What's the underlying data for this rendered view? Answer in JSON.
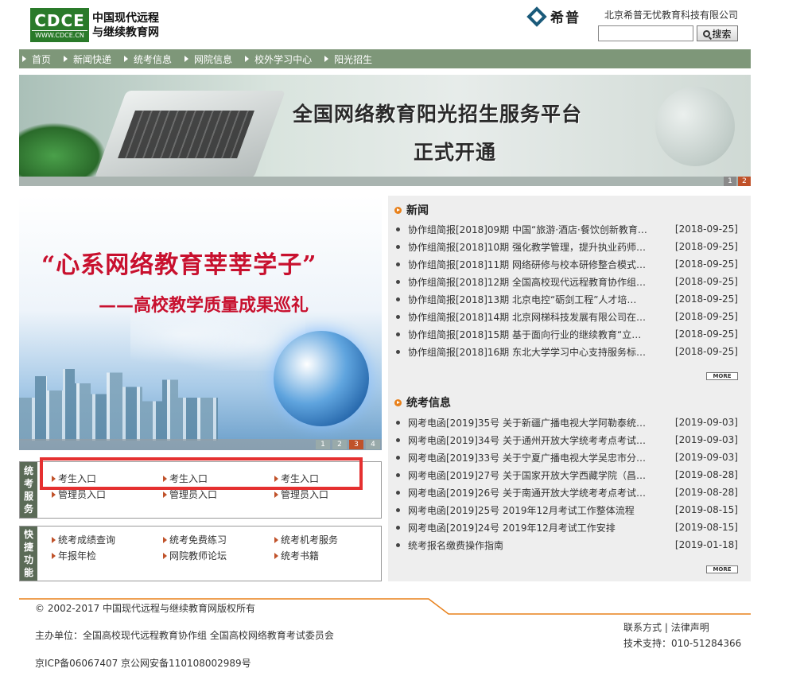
{
  "header": {
    "logo_mark": "CDCE",
    "logo_url": "WWW.CDCE.CN",
    "logo_line1": "中国现代远程",
    "logo_line2": "与继续教育网",
    "partner_name": "希普",
    "company": "北京希普无忧教育科技有限公司",
    "search_placeholder": "",
    "search_button": "搜索"
  },
  "nav": [
    "首页",
    "新闻快递",
    "统考信息",
    "网院信息",
    "校外学习中心",
    "阳光招生"
  ],
  "banner": {
    "title": "全国网络教育阳光招生服务平台",
    "subtitle": "正式开通",
    "pages": [
      "1",
      "2"
    ]
  },
  "slide": {
    "title": "“心系网络教育莘莘学子”",
    "subtitle": "——高校教学质量成果巡礼",
    "pages": [
      "1",
      "2",
      "3",
      "4"
    ]
  },
  "exam_service": {
    "side_label": [
      "统",
      "考",
      "服",
      "务"
    ],
    "row1": [
      "考生入口",
      "考生入口",
      "考生入口"
    ],
    "row2": [
      "管理员入口",
      "管理员入口",
      "管理员入口"
    ]
  },
  "quick": {
    "side_label": [
      "快",
      "捷",
      "功",
      "能"
    ],
    "row1": [
      "统考成绩查询",
      "统考免费练习",
      "统考机考服务"
    ],
    "row2": [
      "年报年检",
      "网院教师论坛",
      "统考书籍"
    ]
  },
  "news": {
    "heading": "新闻",
    "items": [
      {
        "title": "协作组简报[2018]09期 中国“旅游·酒店·餐饮创新教育…",
        "date": "[2018-09-25]"
      },
      {
        "title": "协作组简报[2018]10期 强化教学管理，提升执业药师…",
        "date": "[2018-09-25]"
      },
      {
        "title": "协作组简报[2018]11期 网络研修与校本研修整合模式…",
        "date": "[2018-09-25]"
      },
      {
        "title": "协作组简报[2018]12期 全国高校现代远程教育协作组…",
        "date": "[2018-09-25]"
      },
      {
        "title": "协作组简报[2018]13期 北京电控“砺剑工程”人才培…",
        "date": "[2018-09-25]"
      },
      {
        "title": "协作组简报[2018]14期 北京网梯科技发展有限公司在…",
        "date": "[2018-09-25]"
      },
      {
        "title": "协作组简报[2018]15期 基于面向行业的继续教育“立…",
        "date": "[2018-09-25]"
      },
      {
        "title": "协作组简报[2018]16期 东北大学学习中心支持服务标…",
        "date": "[2018-09-25]"
      }
    ],
    "more": "MORE"
  },
  "exam_info": {
    "heading": "统考信息",
    "items": [
      {
        "title": "网考电函[2019]35号 关于新疆广播电视大学阿勒泰统…",
        "date": "[2019-09-03]"
      },
      {
        "title": "网考电函[2019]34号 关于通州开放大学统考考点考试…",
        "date": "[2019-09-03]"
      },
      {
        "title": "网考电函[2019]33号 关于宁夏广播电视大学吴忠市分…",
        "date": "[2019-09-03]"
      },
      {
        "title": "网考电函[2019]27号 关于国家开放大学西藏学院（昌…",
        "date": "[2019-08-28]"
      },
      {
        "title": "网考电函[2019]26号 关于南通开放大学统考考点考试…",
        "date": "[2019-08-28]"
      },
      {
        "title": "网考电函[2019]25号 2019年12月考试工作整体流程",
        "date": "[2019-08-15]"
      },
      {
        "title": "网考电函[2019]24号 2019年12月考试工作安排",
        "date": "[2019-08-15]"
      },
      {
        "title": "统考报名缴费操作指南",
        "date": "[2019-01-18]"
      }
    ],
    "more": "MORE"
  },
  "footer": {
    "copyright": "© 2002-2017 中国现代远程与继续教育网版权所有",
    "sponsor": "主办单位：全国高校现代远程教育协作组 全国高校网络教育考试委员会",
    "icp": "京ICP备06067407 京公网安备110108002989号",
    "contact": "联系方式",
    "legal": "法律声明",
    "support": "技术支持：010-51284366"
  },
  "colors": {
    "nav_bg": "#7e9779",
    "accent": "#c0522a",
    "highlight": "#e53030",
    "slide_title": "#c8102e"
  }
}
